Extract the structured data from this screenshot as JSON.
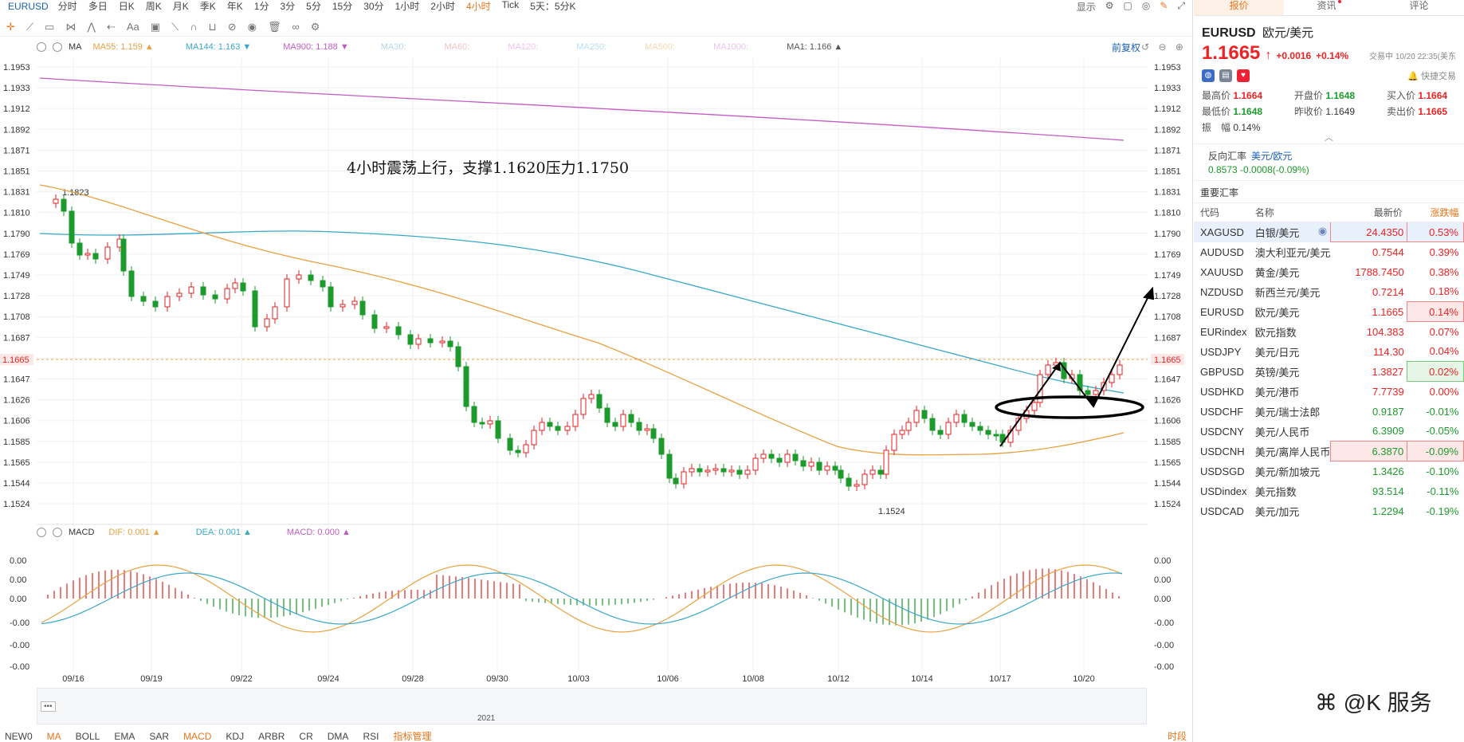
{
  "symbol": "EURUSD",
  "timeframes": [
    "分时",
    "多日",
    "日K",
    "周K",
    "月K",
    "季K",
    "年K",
    "1分",
    "3分",
    "5分",
    "15分",
    "30分",
    "1小时",
    "2小时",
    "4小时",
    "Tick",
    "5天：5分K"
  ],
  "active_timeframe": "4小时",
  "top_right": {
    "display_label": "显示"
  },
  "ma_legend": {
    "label": "MA",
    "items": [
      {
        "text": "MA55: 1.159 ▲",
        "color": "#e8a040"
      },
      {
        "text": "MA144: 1.163 ▼",
        "color": "#3aa7c9"
      },
      {
        "text": "MA900: 1.188 ▼",
        "color": "#c25cc2"
      },
      {
        "text": "MA30:",
        "color": "#b7d8ea"
      },
      {
        "text": "MA60:",
        "color": "#f1c4c4"
      },
      {
        "text": "MA120:",
        "color": "#f1c4ec"
      },
      {
        "text": "MA250:",
        "color": "#b8e0ef"
      },
      {
        "text": "MA500:",
        "color": "#f6d9b0"
      },
      {
        "text": "MA1000:",
        "color": "#e8c4ec"
      },
      {
        "text": "MA1: 1.166 ▲",
        "color": "#555555"
      }
    ],
    "restore_label": "前复权"
  },
  "annotation": "4小时震荡上行，支撑1.1620压力1.1750",
  "price_axis": [
    "1.1953",
    "1.1933",
    "1.1912",
    "1.1892",
    "1.1871",
    "1.1851",
    "1.1831",
    "1.1810",
    "1.1790",
    "1.1769",
    "1.1749",
    "1.1728",
    "1.1708",
    "1.1687",
    "1.1665",
    "1.1647",
    "1.1626",
    "1.1606",
    "1.1585",
    "1.1565",
    "1.1544",
    "1.1524"
  ],
  "current_price_label": "1.1665",
  "high_label": "1.1823",
  "low_label": "1.1524",
  "date_axis": [
    "09/16",
    "09/19",
    "09/22",
    "09/24",
    "09/28",
    "09/30",
    "10/03",
    "10/06",
    "10/08",
    "10/12",
    "10/14",
    "10/17",
    "10/20"
  ],
  "macd_legend": {
    "label": "MACD",
    "items": [
      {
        "text": "DIF: 0.001 ▲",
        "color": "#e8a040"
      },
      {
        "text": "DEA: 0.001 ▲",
        "color": "#3aa7c9"
      },
      {
        "text": "MACD: 0.000 ▲",
        "color": "#c25cc2"
      }
    ]
  },
  "macd_axis": [
    "0.00",
    "0.00",
    "0.00",
    "-0.00",
    "-0.00",
    "-0.00"
  ],
  "navigator_year": "2021",
  "bottom_tabs": [
    "NEW0",
    "MA",
    "BOLL",
    "EMA",
    "SAR",
    "MACD",
    "KDJ",
    "ARBR",
    "CR",
    "DMA",
    "RSI"
  ],
  "bottom_active": [
    "MA",
    "MACD"
  ],
  "indicator_manage": "指标管理",
  "bottom_right": "时段",
  "right_panel": {
    "tabs": [
      "报价",
      "资讯",
      "评论"
    ],
    "active_tab": "报价",
    "symbol": "EURUSD",
    "symbol_cn": "欧元/美元",
    "price": "1.1665",
    "change": "+0.0016",
    "change_pct": "+0.14%",
    "time": "交易中 10/20 22:35(美东",
    "quick_trade": "快捷交易",
    "stats": [
      {
        "k": "最高价",
        "v": "1.1664",
        "dir": "up"
      },
      {
        "k": "开盘价",
        "v": "1.1648",
        "dir": "dn"
      },
      {
        "k": "买入价",
        "v": "1.1664",
        "dir": "up"
      },
      {
        "k": "最低价",
        "v": "1.1648",
        "dir": "dn"
      },
      {
        "k": "昨收价",
        "v": "1.1649",
        "dir": ""
      },
      {
        "k": "卖出价",
        "v": "1.1665",
        "dir": "up"
      },
      {
        "k": "振　幅",
        "v": "0.14%",
        "dir": ""
      }
    ],
    "inverse": {
      "label": "反向汇率",
      "pair": "美元/欧元",
      "value": "0.8573  -0.0008(-0.09%)"
    },
    "section_title": "重要汇率",
    "table_headers": [
      "代码",
      "名称",
      "最新价",
      "涨跌幅"
    ],
    "rows": [
      {
        "code": "XAGUSD",
        "name": "白银/美元",
        "price": "24.4350",
        "pct": "0.53%",
        "dir": "up",
        "box": "r",
        "sel": true
      },
      {
        "code": "AUDUSD",
        "name": "澳大利亚元/美元",
        "price": "0.7544",
        "pct": "0.39%",
        "dir": "up",
        "box": ""
      },
      {
        "code": "XAUUSD",
        "name": "黄金/美元",
        "price": "1788.7450",
        "pct": "0.38%",
        "dir": "up",
        "box": ""
      },
      {
        "code": "NZDUSD",
        "name": "新西兰元/美元",
        "price": "0.7214",
        "pct": "0.18%",
        "dir": "up",
        "box": ""
      },
      {
        "code": "EURUSD",
        "name": "欧元/美元",
        "price": "1.1665",
        "pct": "0.14%",
        "dir": "up",
        "box": "rp"
      },
      {
        "code": "EURindex",
        "name": "欧元指数",
        "price": "104.383",
        "pct": "0.07%",
        "dir": "up",
        "box": ""
      },
      {
        "code": "USDJPY",
        "name": "美元/日元",
        "price": "114.30",
        "pct": "0.04%",
        "dir": "up",
        "box": ""
      },
      {
        "code": "GBPUSD",
        "name": "英镑/美元",
        "price": "1.3827",
        "pct": "0.02%",
        "dir": "up",
        "box": "gp"
      },
      {
        "code": "USDHKD",
        "name": "美元/港币",
        "price": "7.7739",
        "pct": "0.00%",
        "dir": "up",
        "box": ""
      },
      {
        "code": "USDCHF",
        "name": "美元/瑞士法郎",
        "price": "0.9187",
        "pct": "-0.01%",
        "dir": "dn",
        "box": ""
      },
      {
        "code": "USDCNY",
        "name": "美元/人民币",
        "price": "6.3909",
        "pct": "-0.05%",
        "dir": "dn",
        "box": ""
      },
      {
        "code": "USDCNH",
        "name": "美元/离岸人民币",
        "price": "6.3870",
        "pct": "-0.09%",
        "dir": "dn",
        "box": "rall"
      },
      {
        "code": "USDSGD",
        "name": "美元/新加坡元",
        "price": "1.3426",
        "pct": "-0.10%",
        "dir": "dn",
        "box": ""
      },
      {
        "code": "USDindex",
        "name": "美元指数",
        "price": "93.514",
        "pct": "-0.11%",
        "dir": "dn",
        "box": ""
      },
      {
        "code": "USDCAD",
        "name": "美元/加元",
        "price": "1.2294",
        "pct": "-0.19%",
        "dir": "dn",
        "box": ""
      }
    ],
    "watermark": "@K 服务"
  },
  "colors": {
    "up": "#e22222",
    "down": "#1c9a2c",
    "ma55": "#e8a040",
    "ma144": "#3aa7c9",
    "ma900": "#c25cc2"
  }
}
